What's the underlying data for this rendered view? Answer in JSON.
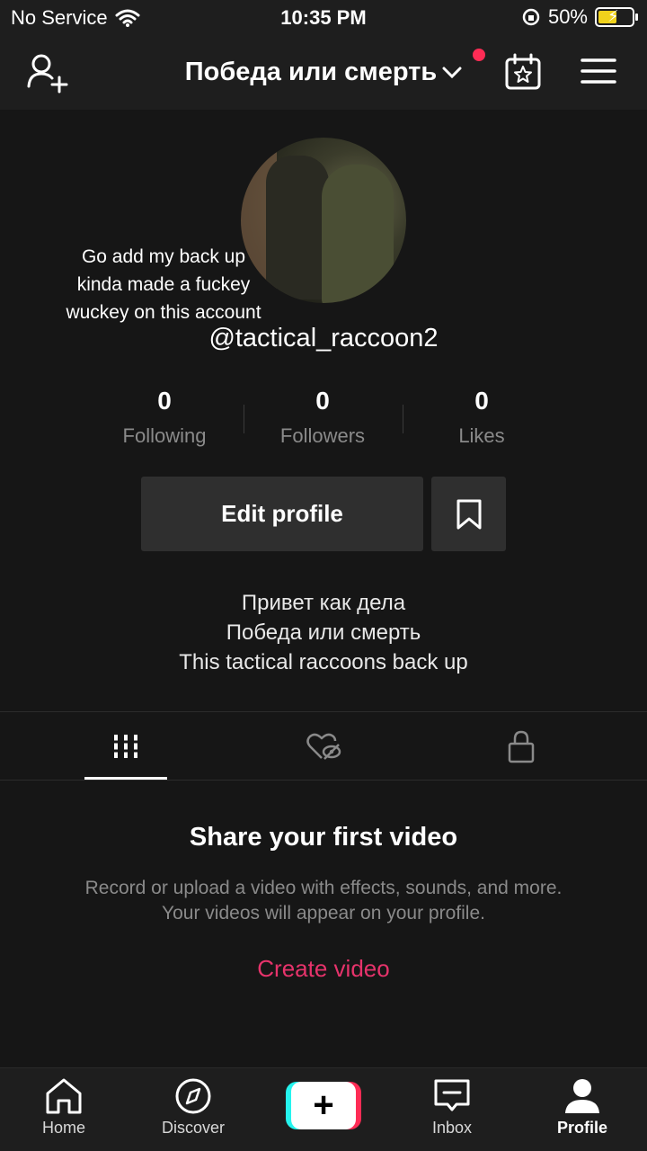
{
  "status_bar": {
    "carrier": "No Service",
    "time": "10:35 PM",
    "battery_percent": "50%"
  },
  "header": {
    "title": "Победа или смерть",
    "icons": [
      "add-user-icon",
      "chevron-down-icon",
      "notification-dot",
      "calendar-star-icon",
      "menu-icon"
    ],
    "accent": "#fe2c55"
  },
  "profile": {
    "overlay_text": [
      "Go add my back up",
      "kinda made a fuckey",
      "wuckey on this account"
    ],
    "username": "@tactical_raccoon2",
    "stats": [
      {
        "num": "0",
        "label": "Following"
      },
      {
        "num": "0",
        "label": "Followers"
      },
      {
        "num": "0",
        "label": "Likes"
      }
    ],
    "edit_label": "Edit profile",
    "bio": [
      "Привет как дела",
      "Победа или смерть",
      "This tactical raccoons back up"
    ]
  },
  "tabs": [
    {
      "icon": "grid-icon",
      "active": true
    },
    {
      "icon": "liked-hidden-icon",
      "active": false
    },
    {
      "icon": "lock-icon",
      "active": false
    }
  ],
  "empty_state": {
    "title": "Share your first video",
    "description": "Record or upload a video with effects, sounds, and more. Your videos will appear on your profile.",
    "action": "Create video",
    "action_color": "#e6336b"
  },
  "bottom_nav": {
    "home": "Home",
    "discover": "Discover",
    "inbox": "Inbox",
    "profile": "Profile"
  }
}
